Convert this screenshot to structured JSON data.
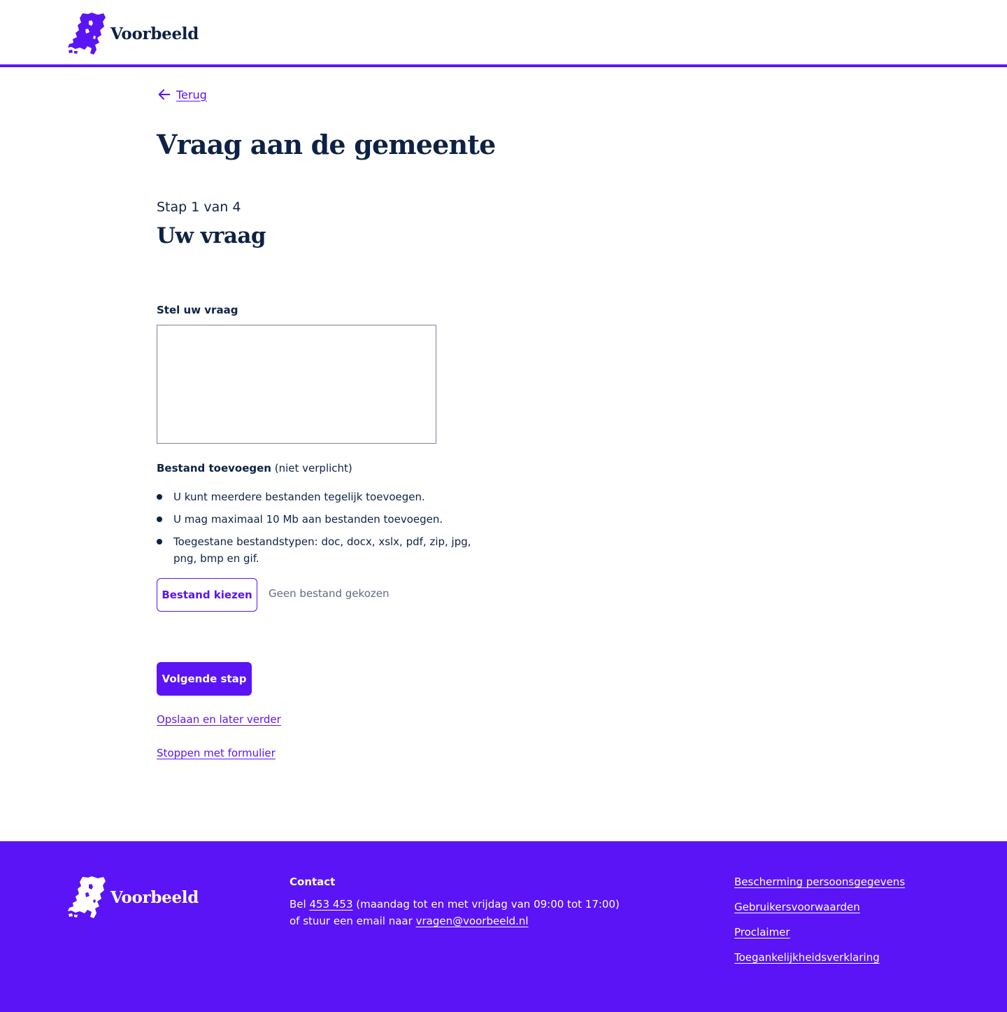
{
  "header": {
    "logo_text": "Voorbeeld"
  },
  "nav": {
    "back_label": "Terug"
  },
  "page": {
    "title": "Vraag aan de gemeente",
    "step_count": "Stap 1 van 4",
    "step_title": "Uw vraag"
  },
  "form": {
    "question_label": "Stel uw vraag",
    "question_value": "",
    "file_label_bold": "Bestand toevoegen",
    "file_label_optional": "(niet verplicht)",
    "hints": [
      "U kunt meerdere bestanden tegelijk toevoegen.",
      "U mag maximaal 10 Mb aan bestanden toevoegen.",
      "Toegestane bestandstypen: doc, docx, xslx, pdf, zip, jpg, png, bmp en gif."
    ],
    "choose_file_label": "Bestand kiezen",
    "no_file_text": "Geen bestand gekozen",
    "next_button_label": "Volgende stap",
    "save_link_label": "Opslaan en later verder",
    "stop_link_label": "Stoppen met formulier"
  },
  "footer": {
    "logo_text": "Voorbeeld",
    "contact_title": "Contact",
    "phone_prefix": "Bel",
    "phone_number": "453 453",
    "phone_hours": "(maandag tot en met vrijdag van 09:00 tot 17:00)",
    "email_prefix": "of stuur een email naar",
    "email": "vragen@voorbeeld.nl",
    "links": [
      "Bescherming persoonsgegevens",
      "Gebruikersvoorwaarden",
      "Proclaimer",
      "Toegankelijkheidsverklaring"
    ]
  },
  "colors": {
    "brand": "#5a14f5",
    "text": "#0d2244",
    "muted": "#5e6b80",
    "white": "#ffffff"
  },
  "icons": {
    "logo": "netherlands-map-icon",
    "back": "arrow-left-icon"
  }
}
